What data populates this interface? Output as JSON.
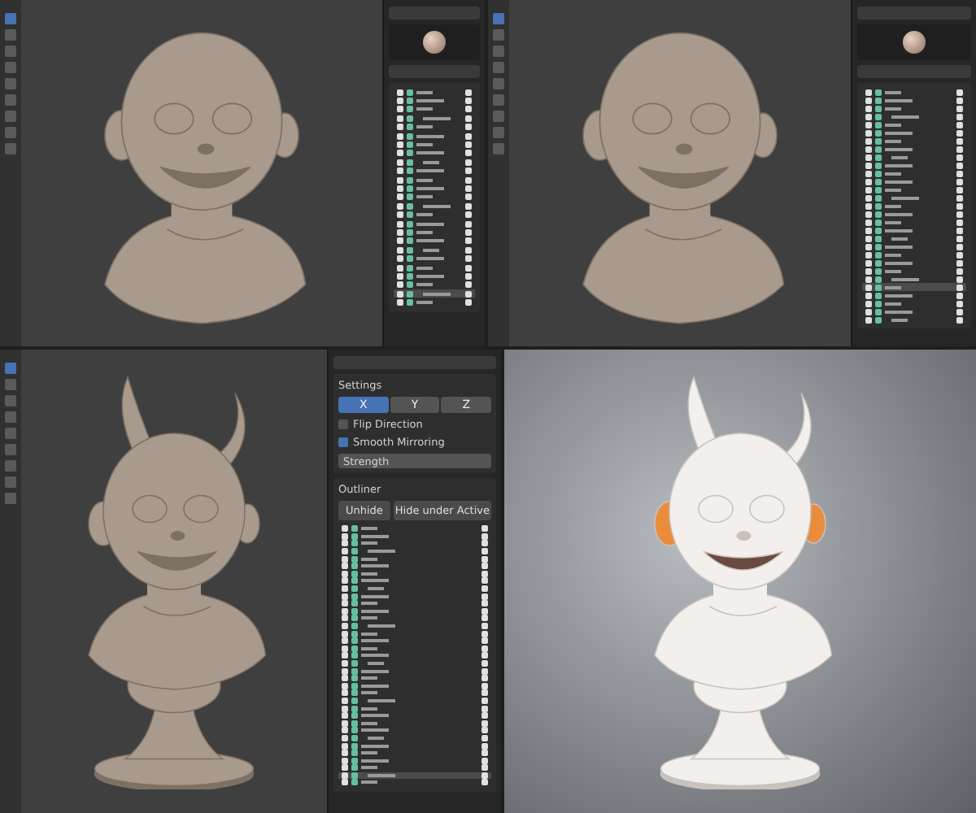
{
  "screens": [
    {
      "kind": "boy",
      "panel": {
        "material_preview": true,
        "rows": [
          {
            "selected": false
          },
          {
            "selected": false
          },
          {
            "selected": false
          },
          {
            "selected": false
          },
          {
            "selected": false
          },
          {
            "selected": false
          },
          {
            "selected": false
          },
          {
            "selected": false
          },
          {
            "selected": false
          },
          {
            "selected": false
          },
          {
            "selected": false
          },
          {
            "selected": false
          },
          {
            "selected": false
          },
          {
            "selected": false
          },
          {
            "selected": false
          },
          {
            "selected": false
          },
          {
            "selected": false
          },
          {
            "selected": false
          },
          {
            "selected": false
          },
          {
            "selected": false
          },
          {
            "selected": false
          },
          {
            "selected": false
          },
          {
            "selected": false
          },
          {
            "selected": true
          },
          {
            "selected": false
          }
        ]
      }
    },
    {
      "kind": "boy",
      "panel": {
        "material_preview": true,
        "rows": [
          {
            "selected": false
          },
          {
            "selected": false
          },
          {
            "selected": false
          },
          {
            "selected": false
          },
          {
            "selected": false
          },
          {
            "selected": false
          },
          {
            "selected": false
          },
          {
            "selected": false
          },
          {
            "selected": false
          },
          {
            "selected": false
          },
          {
            "selected": false
          },
          {
            "selected": false
          },
          {
            "selected": false
          },
          {
            "selected": false
          },
          {
            "selected": false
          },
          {
            "selected": false
          },
          {
            "selected": false
          },
          {
            "selected": false
          },
          {
            "selected": false
          },
          {
            "selected": false
          },
          {
            "selected": false
          },
          {
            "selected": false
          },
          {
            "selected": false
          },
          {
            "selected": false
          },
          {
            "selected": true
          },
          {
            "selected": false
          },
          {
            "selected": false
          },
          {
            "selected": false
          },
          {
            "selected": false
          }
        ]
      }
    },
    {
      "kind": "devil",
      "panel": {
        "material_preview": false,
        "settings_title": "Settings",
        "axes": [
          {
            "label": "X",
            "selected": true
          },
          {
            "label": "Y",
            "selected": false
          },
          {
            "label": "Z",
            "selected": false
          }
        ],
        "options": [
          {
            "label": "Flip Direction",
            "checked": false
          },
          {
            "label": "Smooth Mirroring",
            "checked": true
          }
        ],
        "strength_label": "Strength",
        "outliner_title": "Outliner",
        "buttons": [
          "Unhide",
          "Hide under Active"
        ],
        "rows": [
          {
            "selected": false
          },
          {
            "selected": false
          },
          {
            "selected": false
          },
          {
            "selected": false
          },
          {
            "selected": false
          },
          {
            "selected": false
          },
          {
            "selected": false
          },
          {
            "selected": false
          },
          {
            "selected": false
          },
          {
            "selected": false
          },
          {
            "selected": false
          },
          {
            "selected": false
          },
          {
            "selected": false
          },
          {
            "selected": false
          },
          {
            "selected": false
          },
          {
            "selected": false
          },
          {
            "selected": false
          },
          {
            "selected": false
          },
          {
            "selected": false
          },
          {
            "selected": false
          },
          {
            "selected": false
          },
          {
            "selected": false
          },
          {
            "selected": false
          },
          {
            "selected": false
          },
          {
            "selected": false
          },
          {
            "selected": false
          },
          {
            "selected": false
          },
          {
            "selected": false
          },
          {
            "selected": false
          },
          {
            "selected": false
          },
          {
            "selected": false
          },
          {
            "selected": false
          },
          {
            "selected": false
          },
          {
            "selected": true
          },
          {
            "selected": false
          }
        ]
      }
    }
  ],
  "render": {
    "kind": "devil"
  }
}
